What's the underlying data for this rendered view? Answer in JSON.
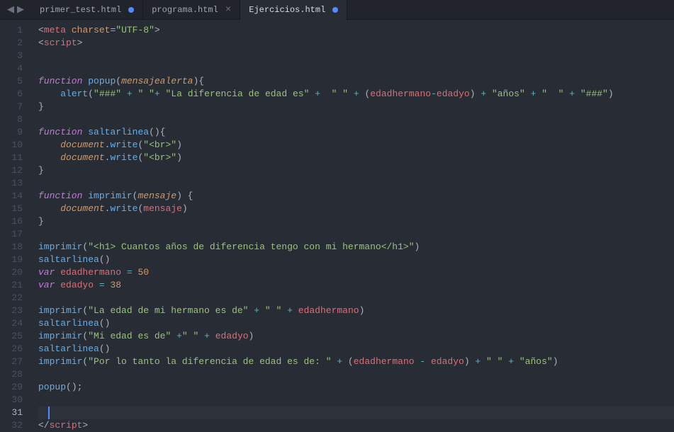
{
  "tabs": [
    {
      "label": "primer_test.html",
      "modified": true,
      "active": false
    },
    {
      "label": "programa.html",
      "modified": false,
      "active": false
    },
    {
      "label": "Ejercicios.html",
      "modified": true,
      "active": true
    }
  ],
  "cursor_line": 31,
  "code": {
    "lines": [
      {
        "n": 1,
        "t": [
          [
            "p-gray",
            "<"
          ],
          [
            "k-red",
            "meta"
          ],
          [
            "p-gray",
            " "
          ],
          [
            "attr",
            "charset"
          ],
          [
            "p-gray",
            "="
          ],
          [
            "str",
            "\"UTF-8\""
          ],
          [
            "p-gray",
            ">"
          ]
        ]
      },
      {
        "n": 2,
        "t": [
          [
            "p-gray",
            "<"
          ],
          [
            "k-red",
            "script"
          ],
          [
            "p-gray",
            ">"
          ]
        ]
      },
      {
        "n": 3,
        "t": []
      },
      {
        "n": 4,
        "t": []
      },
      {
        "n": 5,
        "t": [
          [
            "k-purple",
            "function"
          ],
          [
            "p-gray",
            " "
          ],
          [
            "fn-blue",
            "popup"
          ],
          [
            "p-gray",
            "("
          ],
          [
            "param",
            "mensajealerta"
          ],
          [
            "p-gray",
            "){"
          ]
        ]
      },
      {
        "n": 6,
        "t": [
          [
            "p-gray",
            "    "
          ],
          [
            "fn-blue",
            "alert"
          ],
          [
            "p-gray",
            "("
          ],
          [
            "str",
            "\"###\""
          ],
          [
            "p-gray",
            " "
          ],
          [
            "op",
            "+"
          ],
          [
            "p-gray",
            " "
          ],
          [
            "str",
            "\" \""
          ],
          [
            "op",
            "+"
          ],
          [
            "p-gray",
            " "
          ],
          [
            "str",
            "\"La diferencia de edad es\""
          ],
          [
            "p-gray",
            " "
          ],
          [
            "op",
            "+"
          ],
          [
            "p-gray",
            "  "
          ],
          [
            "str",
            "\" \""
          ],
          [
            "p-gray",
            " "
          ],
          [
            "op",
            "+"
          ],
          [
            "p-gray",
            " ("
          ],
          [
            "ident",
            "edadhermano"
          ],
          [
            "op",
            "-"
          ],
          [
            "ident",
            "edadyo"
          ],
          [
            "p-gray",
            ") "
          ],
          [
            "op",
            "+"
          ],
          [
            "p-gray",
            " "
          ],
          [
            "str",
            "\"años\""
          ],
          [
            "p-gray",
            " "
          ],
          [
            "op",
            "+"
          ],
          [
            "p-gray",
            " "
          ],
          [
            "str",
            "\"  \""
          ],
          [
            "p-gray",
            " "
          ],
          [
            "op",
            "+"
          ],
          [
            "p-gray",
            " "
          ],
          [
            "str",
            "\"###\""
          ],
          [
            "p-gray",
            ")"
          ]
        ]
      },
      {
        "n": 7,
        "t": [
          [
            "p-gray",
            "}"
          ]
        ]
      },
      {
        "n": 8,
        "t": []
      },
      {
        "n": 9,
        "t": [
          [
            "k-purple",
            "function"
          ],
          [
            "p-gray",
            " "
          ],
          [
            "fn-blue",
            "saltarlinea"
          ],
          [
            "p-gray",
            "(){"
          ]
        ]
      },
      {
        "n": 10,
        "t": [
          [
            "p-gray",
            "    "
          ],
          [
            "param",
            "document"
          ],
          [
            "p-gray",
            "."
          ],
          [
            "fn-blue",
            "write"
          ],
          [
            "p-gray",
            "("
          ],
          [
            "str",
            "\"<br>\""
          ],
          [
            "p-gray",
            ")"
          ]
        ]
      },
      {
        "n": 11,
        "t": [
          [
            "p-gray",
            "    "
          ],
          [
            "param",
            "document"
          ],
          [
            "p-gray",
            "."
          ],
          [
            "fn-blue",
            "write"
          ],
          [
            "p-gray",
            "("
          ],
          [
            "str",
            "\"<br>\""
          ],
          [
            "p-gray",
            ")"
          ]
        ]
      },
      {
        "n": 12,
        "t": [
          [
            "p-gray",
            "}"
          ]
        ]
      },
      {
        "n": 13,
        "t": []
      },
      {
        "n": 14,
        "t": [
          [
            "k-purple",
            "function"
          ],
          [
            "p-gray",
            " "
          ],
          [
            "fn-blue",
            "imprimir"
          ],
          [
            "p-gray",
            "("
          ],
          [
            "param",
            "mensaje"
          ],
          [
            "p-gray",
            ") {"
          ]
        ]
      },
      {
        "n": 15,
        "t": [
          [
            "p-gray",
            "    "
          ],
          [
            "param",
            "document"
          ],
          [
            "p-gray",
            "."
          ],
          [
            "fn-blue",
            "write"
          ],
          [
            "p-gray",
            "("
          ],
          [
            "ident",
            "mensaje"
          ],
          [
            "p-gray",
            ")"
          ]
        ]
      },
      {
        "n": 16,
        "t": [
          [
            "p-gray",
            "}"
          ]
        ]
      },
      {
        "n": 17,
        "t": []
      },
      {
        "n": 18,
        "t": [
          [
            "fn-blue",
            "imprimir"
          ],
          [
            "p-gray",
            "("
          ],
          [
            "str",
            "\"<h1> Cuantos años de diferencia tengo con mi hermano</h1>\""
          ],
          [
            "p-gray",
            ")"
          ]
        ]
      },
      {
        "n": 19,
        "t": [
          [
            "fn-blue",
            "saltarlinea"
          ],
          [
            "p-gray",
            "()"
          ]
        ]
      },
      {
        "n": 20,
        "t": [
          [
            "k-purple",
            "var"
          ],
          [
            "p-gray",
            " "
          ],
          [
            "ident",
            "edadhermano"
          ],
          [
            "p-gray",
            " "
          ],
          [
            "op",
            "="
          ],
          [
            "p-gray",
            " "
          ],
          [
            "attr",
            "50"
          ]
        ]
      },
      {
        "n": 21,
        "t": [
          [
            "k-purple",
            "var"
          ],
          [
            "p-gray",
            " "
          ],
          [
            "ident",
            "edadyo"
          ],
          [
            "p-gray",
            " "
          ],
          [
            "op",
            "="
          ],
          [
            "p-gray",
            " "
          ],
          [
            "attr",
            "38"
          ]
        ]
      },
      {
        "n": 22,
        "t": []
      },
      {
        "n": 23,
        "t": [
          [
            "fn-blue",
            "imprimir"
          ],
          [
            "p-gray",
            "("
          ],
          [
            "str",
            "\"La edad de mi hermano es de\""
          ],
          [
            "p-gray",
            " "
          ],
          [
            "op",
            "+"
          ],
          [
            "p-gray",
            " "
          ],
          [
            "str",
            "\" \""
          ],
          [
            "p-gray",
            " "
          ],
          [
            "op",
            "+"
          ],
          [
            "p-gray",
            " "
          ],
          [
            "ident",
            "edadhermano"
          ],
          [
            "p-gray",
            ")"
          ]
        ]
      },
      {
        "n": 24,
        "t": [
          [
            "fn-blue",
            "saltarlinea"
          ],
          [
            "p-gray",
            "()"
          ]
        ]
      },
      {
        "n": 25,
        "t": [
          [
            "fn-blue",
            "imprimir"
          ],
          [
            "p-gray",
            "("
          ],
          [
            "str",
            "\"Mi edad es de\""
          ],
          [
            "p-gray",
            " "
          ],
          [
            "op",
            "+"
          ],
          [
            "str",
            "\" \""
          ],
          [
            "p-gray",
            " "
          ],
          [
            "op",
            "+"
          ],
          [
            "p-gray",
            " "
          ],
          [
            "ident",
            "edadyo"
          ],
          [
            "p-gray",
            ")"
          ]
        ]
      },
      {
        "n": 26,
        "t": [
          [
            "fn-blue",
            "saltarlinea"
          ],
          [
            "p-gray",
            "()"
          ]
        ]
      },
      {
        "n": 27,
        "t": [
          [
            "fn-blue",
            "imprimir"
          ],
          [
            "p-gray",
            "("
          ],
          [
            "str",
            "\"Por lo tanto la diferencia de edad es de: \""
          ],
          [
            "p-gray",
            " "
          ],
          [
            "op",
            "+"
          ],
          [
            "p-gray",
            " ("
          ],
          [
            "ident",
            "edadhermano"
          ],
          [
            "p-gray",
            " "
          ],
          [
            "op",
            "-"
          ],
          [
            "p-gray",
            " "
          ],
          [
            "ident",
            "edadyo"
          ],
          [
            "p-gray",
            ") "
          ],
          [
            "op",
            "+"
          ],
          [
            "p-gray",
            " "
          ],
          [
            "str",
            "\" \""
          ],
          [
            "p-gray",
            " "
          ],
          [
            "op",
            "+"
          ],
          [
            "p-gray",
            " "
          ],
          [
            "str",
            "\"años\""
          ],
          [
            "p-gray",
            ")"
          ]
        ]
      },
      {
        "n": 28,
        "t": []
      },
      {
        "n": 29,
        "t": [
          [
            "fn-blue",
            "popup"
          ],
          [
            "p-gray",
            "();"
          ]
        ]
      },
      {
        "n": 30,
        "t": []
      },
      {
        "n": 31,
        "t": []
      },
      {
        "n": 32,
        "t": [
          [
            "p-gray",
            "</"
          ],
          [
            "k-red",
            "script"
          ],
          [
            "p-gray",
            ">"
          ]
        ]
      }
    ]
  }
}
